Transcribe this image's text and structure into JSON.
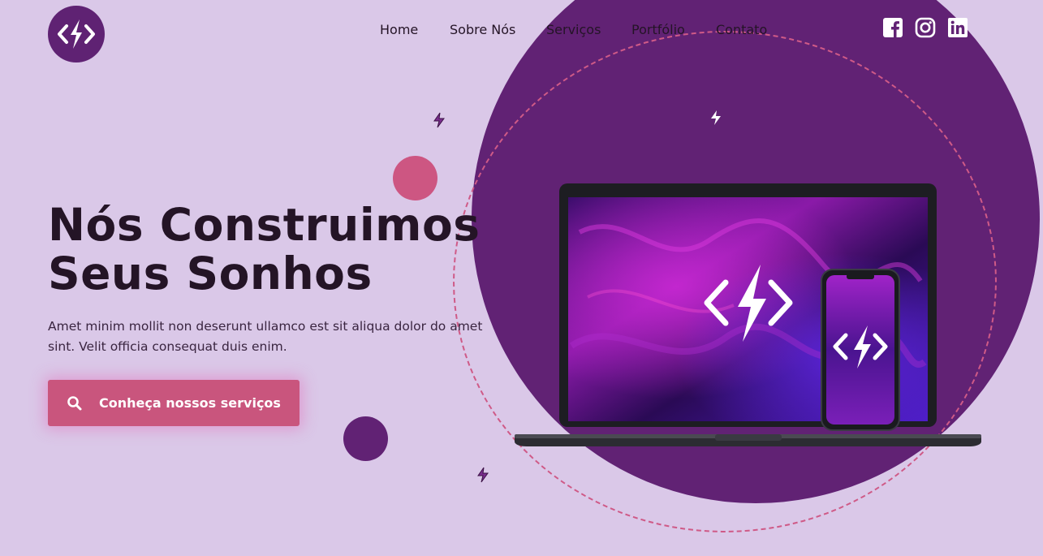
{
  "nav": {
    "items": [
      {
        "label": "Home"
      },
      {
        "label": "Sobre Nós"
      },
      {
        "label": "Serviços"
      },
      {
        "label": "Portfólio"
      },
      {
        "label": "Contato"
      }
    ]
  },
  "social": [
    "facebook-icon",
    "instagram-icon",
    "linkedin-icon"
  ],
  "hero": {
    "title_line1": "Nós Construimos",
    "title_line2": "Seus Sonhos",
    "description": "Amet minim mollit non deserunt ullamco est sit aliqua dolor do amet sint. Velit officia consequat duis enim.",
    "cta_label": "Conheça nossos serviços",
    "cta_icon": "search-icon"
  },
  "colors": {
    "background": "#dac8e8",
    "brand_purple": "#612274",
    "accent_pink": "#c9557d",
    "text_dark": "#241426"
  }
}
